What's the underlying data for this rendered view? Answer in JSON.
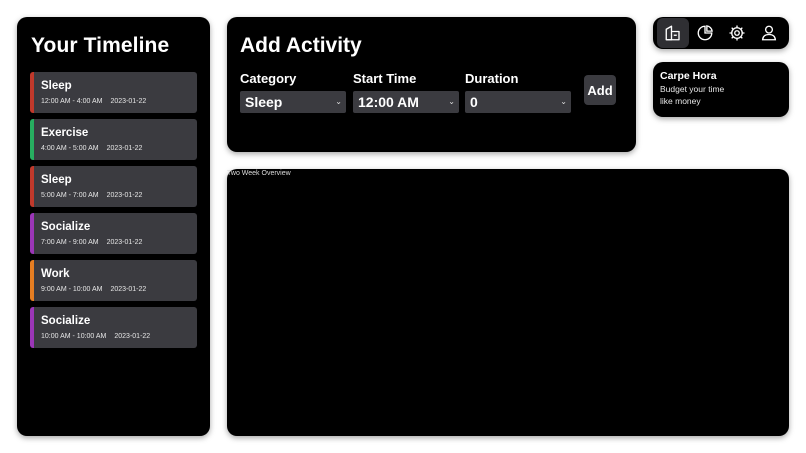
{
  "timeline": {
    "title": "Your Timeline",
    "entries": [
      {
        "name": "Sleep",
        "time": "12:00 AM - 4:00 AM",
        "date": "2023-01-22",
        "color": "#c0392b"
      },
      {
        "name": "Exercise",
        "time": "4:00 AM - 5:00 AM",
        "date": "2023-01-22",
        "color": "#27ae60"
      },
      {
        "name": "Sleep",
        "time": "5:00 AM - 7:00 AM",
        "date": "2023-01-22",
        "color": "#c0392b"
      },
      {
        "name": "Socialize",
        "time": "7:00 AM - 9:00 AM",
        "date": "2023-01-22",
        "color": "#9b36b7"
      },
      {
        "name": "Work",
        "time": "9:00 AM - 10:00 AM",
        "date": "2023-01-22",
        "color": "#e67e22"
      },
      {
        "name": "Socialize",
        "time": "10:00 AM - 10:00 AM",
        "date": "2023-01-22",
        "color": "#9b36b7"
      }
    ]
  },
  "add_activity": {
    "title": "Add Activity",
    "category_label": "Category",
    "category_value": "Sleep",
    "start_label": "Start Time",
    "start_value": "12:00 AM",
    "duration_label": "Duration",
    "duration_value": "0",
    "add_label": "Add"
  },
  "nav": {
    "icons": [
      "home-icon",
      "pie-chart-icon",
      "gear-icon",
      "user-icon"
    ],
    "active": "home-icon"
  },
  "info": {
    "title": "Carpe Hora",
    "line1": "Budget your time",
    "line2": "like money"
  },
  "overview": {
    "caption": "Two Week Overview"
  }
}
